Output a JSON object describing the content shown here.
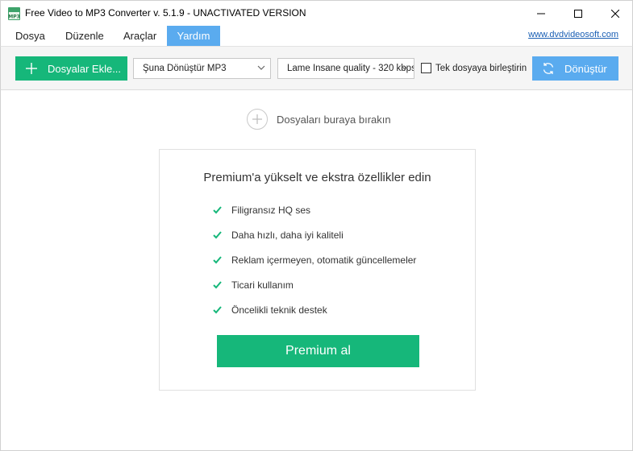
{
  "window": {
    "title": "Free Video to MP3 Converter v. 5.1.9 - UNACTIVATED VERSION",
    "app_icon": "mp3-app-icon"
  },
  "menu": {
    "items": [
      {
        "label": "Dosya",
        "active": false
      },
      {
        "label": "Düzenle",
        "active": false
      },
      {
        "label": "Araçlar",
        "active": false
      },
      {
        "label": "Yardım",
        "active": true
      }
    ],
    "site_link": "www.dvdvideosoft.com"
  },
  "toolbar": {
    "add_files_label": "Dosyalar Ekle...",
    "format_select": {
      "value": "Şuna Dönüştür MP3"
    },
    "quality_select": {
      "value": "Lame Insane quality - 320 kbps"
    },
    "merge_checkbox": {
      "label": "Tek dosyaya birleştirin",
      "checked": false
    },
    "convert_label": "Dönüştür"
  },
  "main": {
    "drop_hint": "Dosyaları buraya bırakın",
    "card": {
      "title": "Premium'a yükselt ve ekstra özellikler edin",
      "features": [
        "Filigransız HQ ses",
        "Daha hızlı, daha iyi kaliteli",
        "Reklam içermeyen, otomatik güncellemeler",
        "Ticari kullanım",
        "Öncelikli teknik destek"
      ],
      "button_label": "Premium al"
    }
  },
  "colors": {
    "green_accent": "#16b77a",
    "blue_accent": "#5aabef",
    "link": "#1a5fb4"
  }
}
